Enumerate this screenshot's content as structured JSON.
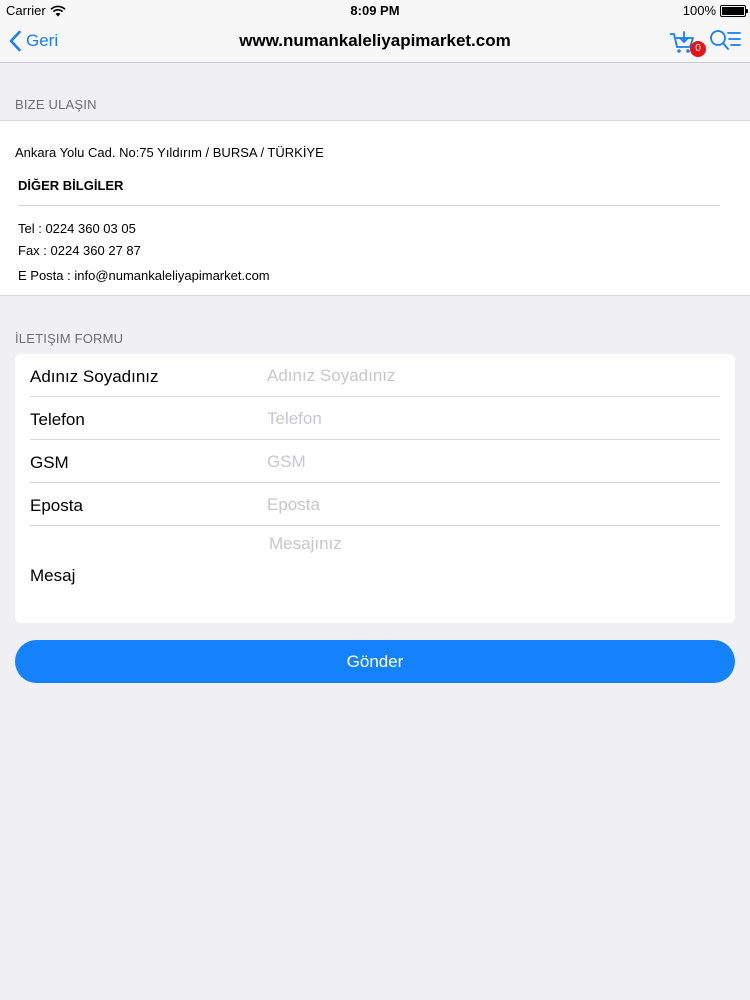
{
  "status_bar": {
    "carrier": "Carrier",
    "time": "8:09 PM",
    "battery": "100%"
  },
  "nav": {
    "back_label": "Geri",
    "title": "www.numankaleliyapimarket.com",
    "cart_count": "0",
    "accent_color": "#157efb"
  },
  "contact": {
    "header": "BIZE ULAŞIN",
    "address": "Ankara Yolu Cad. No:75 Yıldırım / BURSA / TÜRKİYE",
    "other_title": "DİĞER BİLGİLER",
    "tel": "Tel : 0224 360 03 05",
    "fax": "Fax : 0224 360 27 87",
    "email": "E Posta : info@numankaleliyapimarket.com"
  },
  "form": {
    "header": "İLETIŞIM FORMU",
    "name_label": "Adınız Soyadınız",
    "name_placeholder": "Adınız Soyadınız",
    "phone_label": "Telefon",
    "phone_placeholder": "Telefon",
    "gsm_label": "GSM",
    "gsm_placeholder": "GSM",
    "email_label": "Eposta",
    "email_placeholder": "Eposta",
    "message_label": "Mesaj",
    "message_placeholder": "Mesajınız",
    "submit_label": "Gönder",
    "submit_color": "#1382fb"
  }
}
